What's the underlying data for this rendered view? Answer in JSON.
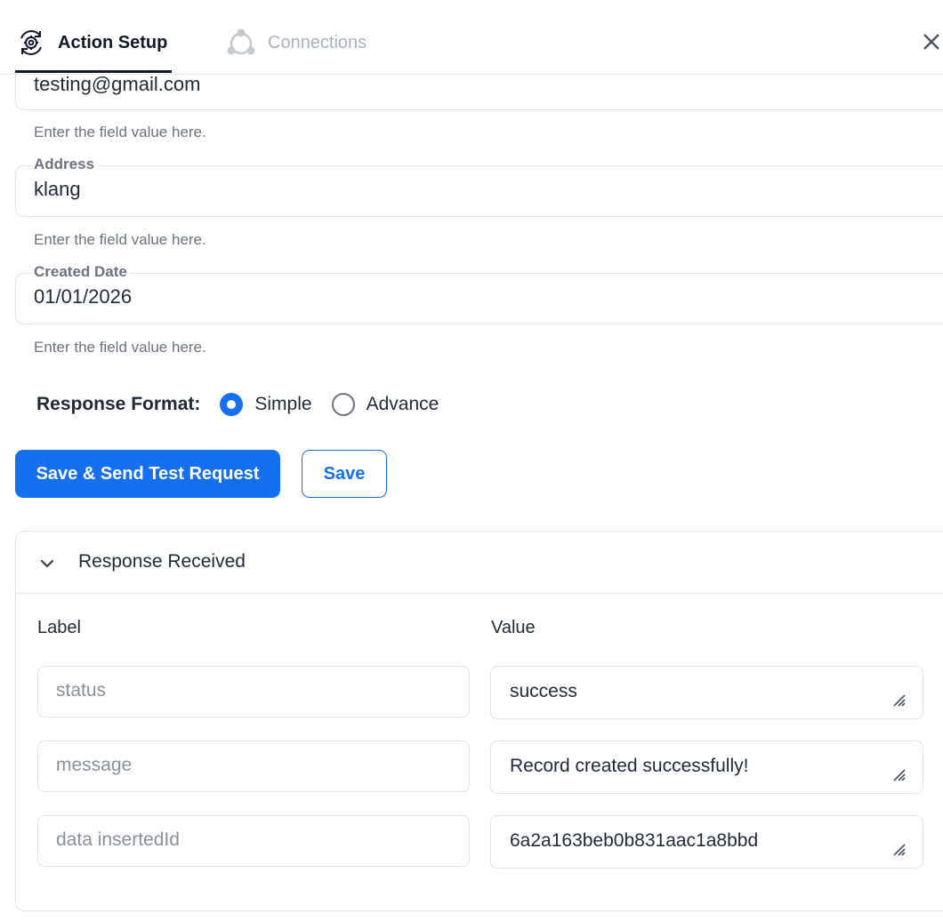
{
  "header": {
    "tabs": [
      {
        "label": "Action Setup",
        "icon": "gear-sync-icon",
        "active": true
      },
      {
        "label": "Connections",
        "icon": "connections-icon",
        "active": false
      }
    ],
    "close_icon": "close-icon"
  },
  "fields": [
    {
      "label": "",
      "value": "testing@gmail.com",
      "helper": "Enter the field value here."
    },
    {
      "label": "Address",
      "value": "klang",
      "helper": "Enter the field value here."
    },
    {
      "label": "Created Date",
      "value": "01/01/2026",
      "helper": "Enter the field value here."
    }
  ],
  "response_format": {
    "label": "Response Format:",
    "options": [
      {
        "label": "Simple",
        "checked": true
      },
      {
        "label": "Advance",
        "checked": false
      }
    ]
  },
  "buttons": {
    "save_send": "Save & Send Test Request",
    "save": "Save"
  },
  "response_panel": {
    "title": "Response Received",
    "expanded": true,
    "label_header": "Label",
    "value_header": "Value",
    "rows": [
      {
        "label": "status",
        "value": "success"
      },
      {
        "label": "message",
        "value": "Record created successfully!"
      },
      {
        "label": "data insertedId",
        "value": "6a2a163beb0b831aac1a8bbd"
      }
    ]
  },
  "colors": {
    "accent": "#1570ef",
    "text": "#1f2937",
    "muted": "#6b7280",
    "border": "#e0e3e8"
  }
}
